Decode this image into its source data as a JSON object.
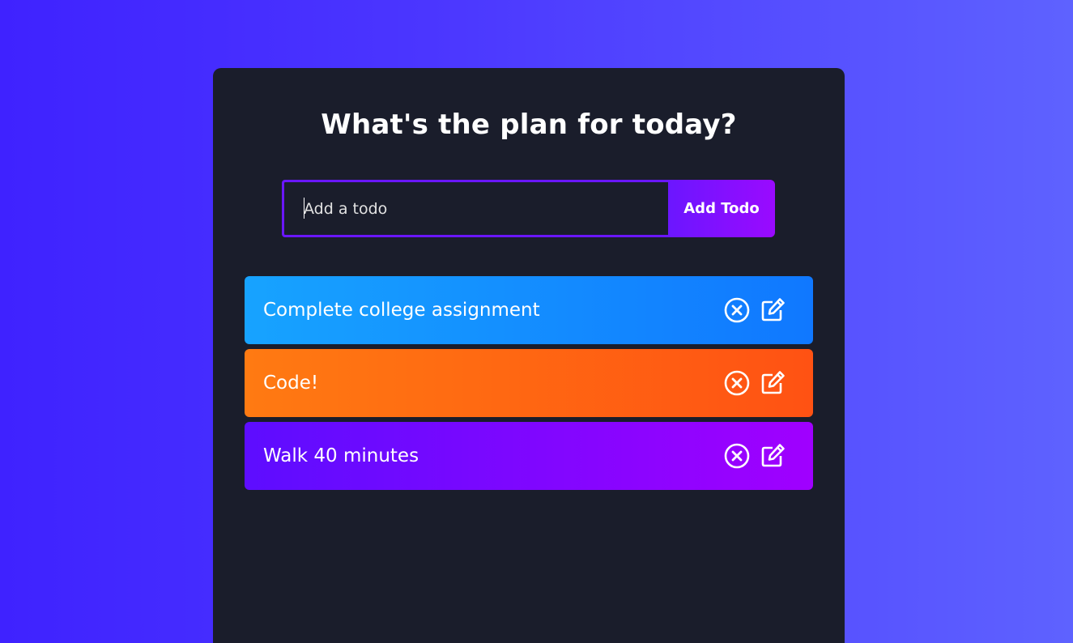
{
  "header": {
    "title": "What's the plan for today?"
  },
  "form": {
    "placeholder": "Add a todo",
    "value": "",
    "button_label": "Add Todo"
  },
  "todos": [
    {
      "text": "Complete college assignment",
      "color_start": "#17a3ff",
      "color_end": "#1078ff",
      "delete_icon": "close-circle-icon",
      "edit_icon": "edit-icon"
    },
    {
      "text": "Code!",
      "color_start": "#ff7a12",
      "color_end": "#ff5213",
      "delete_icon": "close-circle-icon",
      "edit_icon": "edit-icon"
    },
    {
      "text": "Walk 40 minutes",
      "color_start": "#5d0dff",
      "color_end": "#a000ff",
      "delete_icon": "close-circle-icon",
      "edit_icon": "edit-icon"
    }
  ],
  "colors": {
    "background_start": "#3f22ff",
    "background_end": "#5e62ff",
    "panel": "#1a1d2b",
    "accent": "#6a16ff"
  }
}
